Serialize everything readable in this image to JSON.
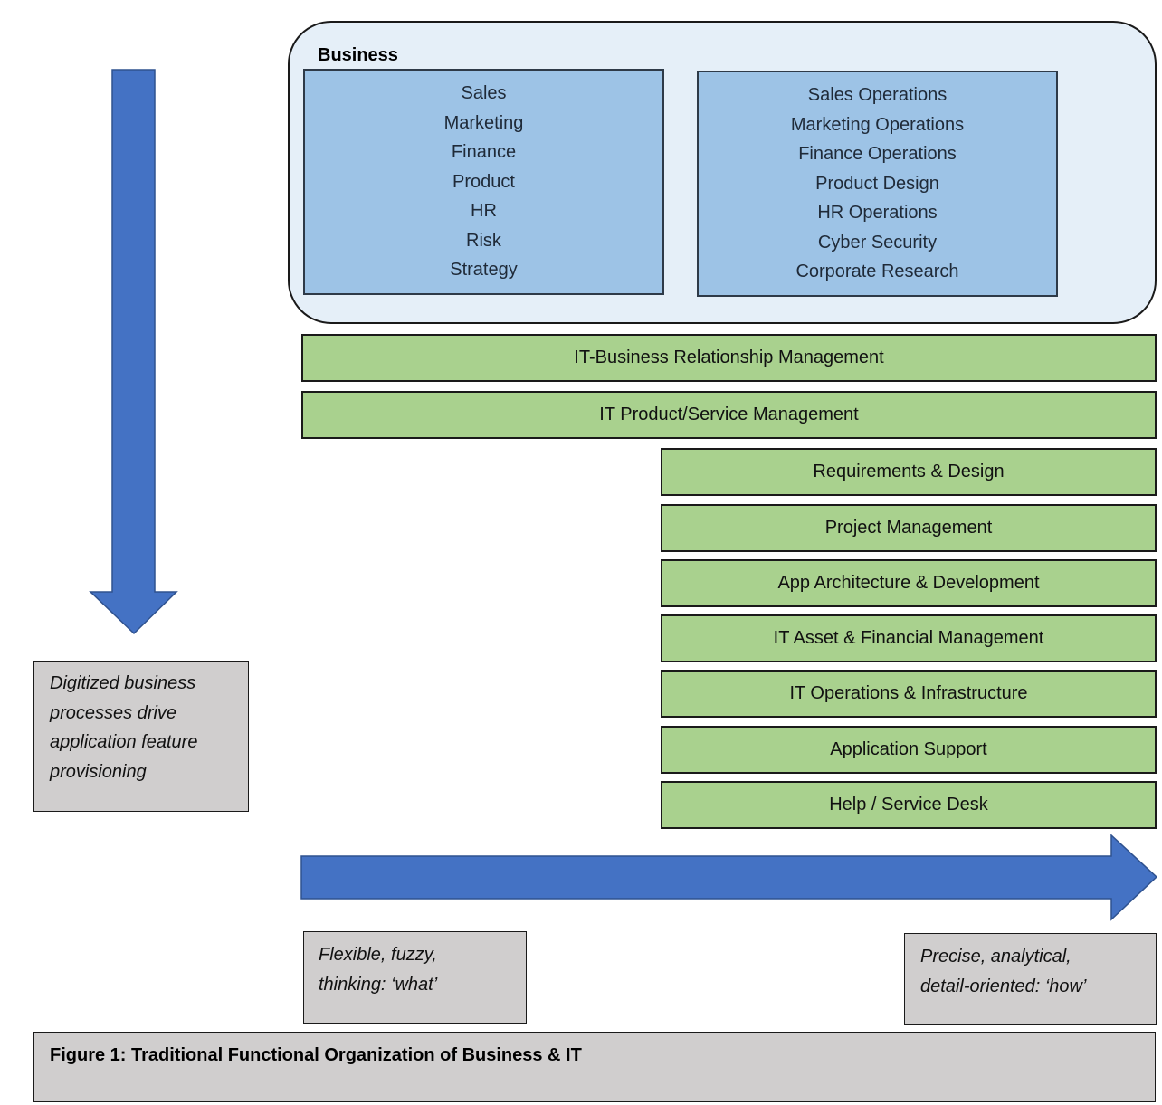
{
  "colors": {
    "business_container_fill": "#e5eff8",
    "business_box_fill": "#9dc3e6",
    "it_bar_fill": "#a9d18e",
    "note_fill": "#d0cece",
    "arrow_fill": "#4472c4"
  },
  "business": {
    "title": "Business",
    "left_functions": [
      "Sales",
      "Marketing",
      "Finance",
      "Product",
      "HR",
      "Risk",
      "Strategy"
    ],
    "right_functions": [
      "Sales Operations",
      "Marketing Operations",
      "Finance Operations",
      "Product Design",
      "HR Operations",
      "Cyber Security",
      "Corporate Research"
    ]
  },
  "it_bars_wide": [
    "IT-Business Relationship Management",
    "IT Product/Service Management"
  ],
  "it_bars_narrow": [
    "Requirements & Design",
    "Project Management",
    "App Architecture & Development",
    "IT Asset & Financial Management",
    "IT Operations & Infrastructure",
    "Application Support",
    "Help / Service Desk"
  ],
  "notes": {
    "left": [
      "Digitized business",
      "processes drive",
      "application feature",
      "provisioning"
    ],
    "bottom_left": [
      "Flexible, fuzzy,",
      "thinking: ‘what’"
    ],
    "bottom_right": [
      "Precise, analytical,",
      "detail-oriented: ‘how’"
    ]
  },
  "arrows": {
    "vertical": "down-arrow",
    "horizontal": "right-arrow"
  },
  "caption": "Figure 1: Traditional Functional Organization of Business & IT"
}
